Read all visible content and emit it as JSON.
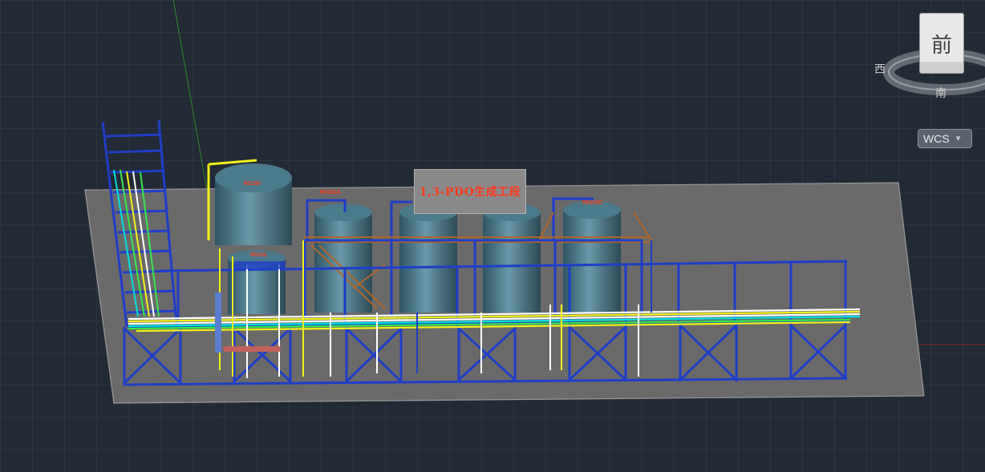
{
  "banner": {
    "text": "1,3-PDO生成工段"
  },
  "tank_labels": {
    "t1": "R0100",
    "t2": "R0102",
    "t3": "R0103A",
    "t4": "R0103C"
  },
  "viewcube": {
    "face_label": "前",
    "west_label": "西",
    "south_label": "南"
  },
  "wcs_menu": {
    "label": "WCS"
  },
  "colors": {
    "background": "#222a35",
    "grid": "#3a4452",
    "ground": "#6b6b6b",
    "steel_blue": "#1f3ec8",
    "pipe_yellow": "#f2f21a",
    "pipe_white": "#ffffff",
    "tank": "#3f6a78",
    "platform_orange": "#b0662a",
    "label_red": "#ff3a1a"
  }
}
